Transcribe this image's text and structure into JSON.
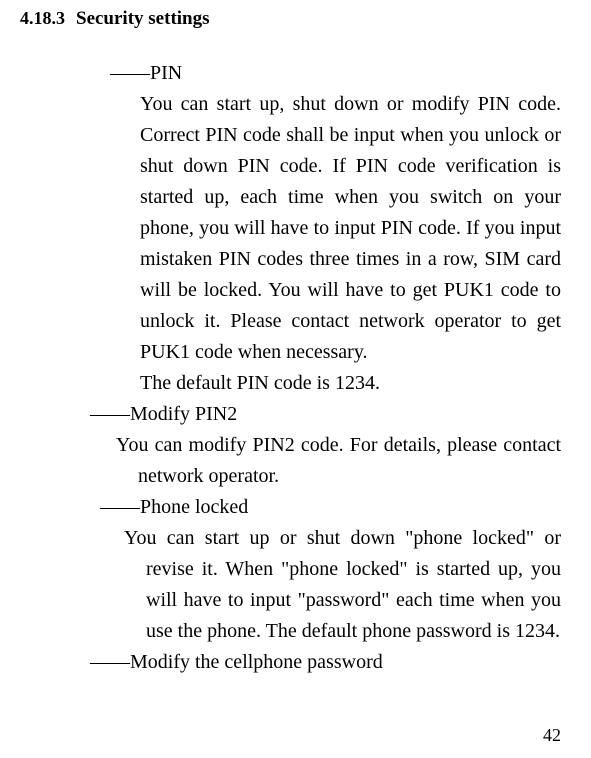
{
  "heading": {
    "number": "4.18.3",
    "title": "Security settings"
  },
  "groups": [
    {
      "title_prefix": "――",
      "title": "PIN",
      "body": "You can start up, shut down or modify PIN code. Correct PIN code shall be input when you unlock or shut down PIN code. If PIN code verification is started up, each time when you switch on your phone, you will have to input PIN code. If you input mistaken PIN codes three times in a row, SIM card will be locked. You will have to get PUK1 code to unlock it. Please contact network operator to get PUK1 code when necessary.",
      "extra": "The default PIN code is 1234.",
      "title_class": "t1",
      "body_class": "b1"
    },
    {
      "title_prefix": "――",
      "title": "Modify PIN2",
      "body": "You can modify PIN2 code. For details, please contact network operator.",
      "title_class": "t2",
      "body_class": "b2"
    },
    {
      "title_prefix": "――",
      "title": "Phone locked",
      "body": "You can start up or shut down \"phone locked\" or revise it. When \"phone locked\" is started up, you will have to input \"password\" each time when you use the phone. The default phone password is 1234.",
      "title_class": "t3",
      "body_class": "b3"
    },
    {
      "title_prefix": "――",
      "title": "Modify the cellphone password",
      "body": "",
      "title_class": "t2",
      "body_class": "b2"
    }
  ],
  "page_number": "42"
}
